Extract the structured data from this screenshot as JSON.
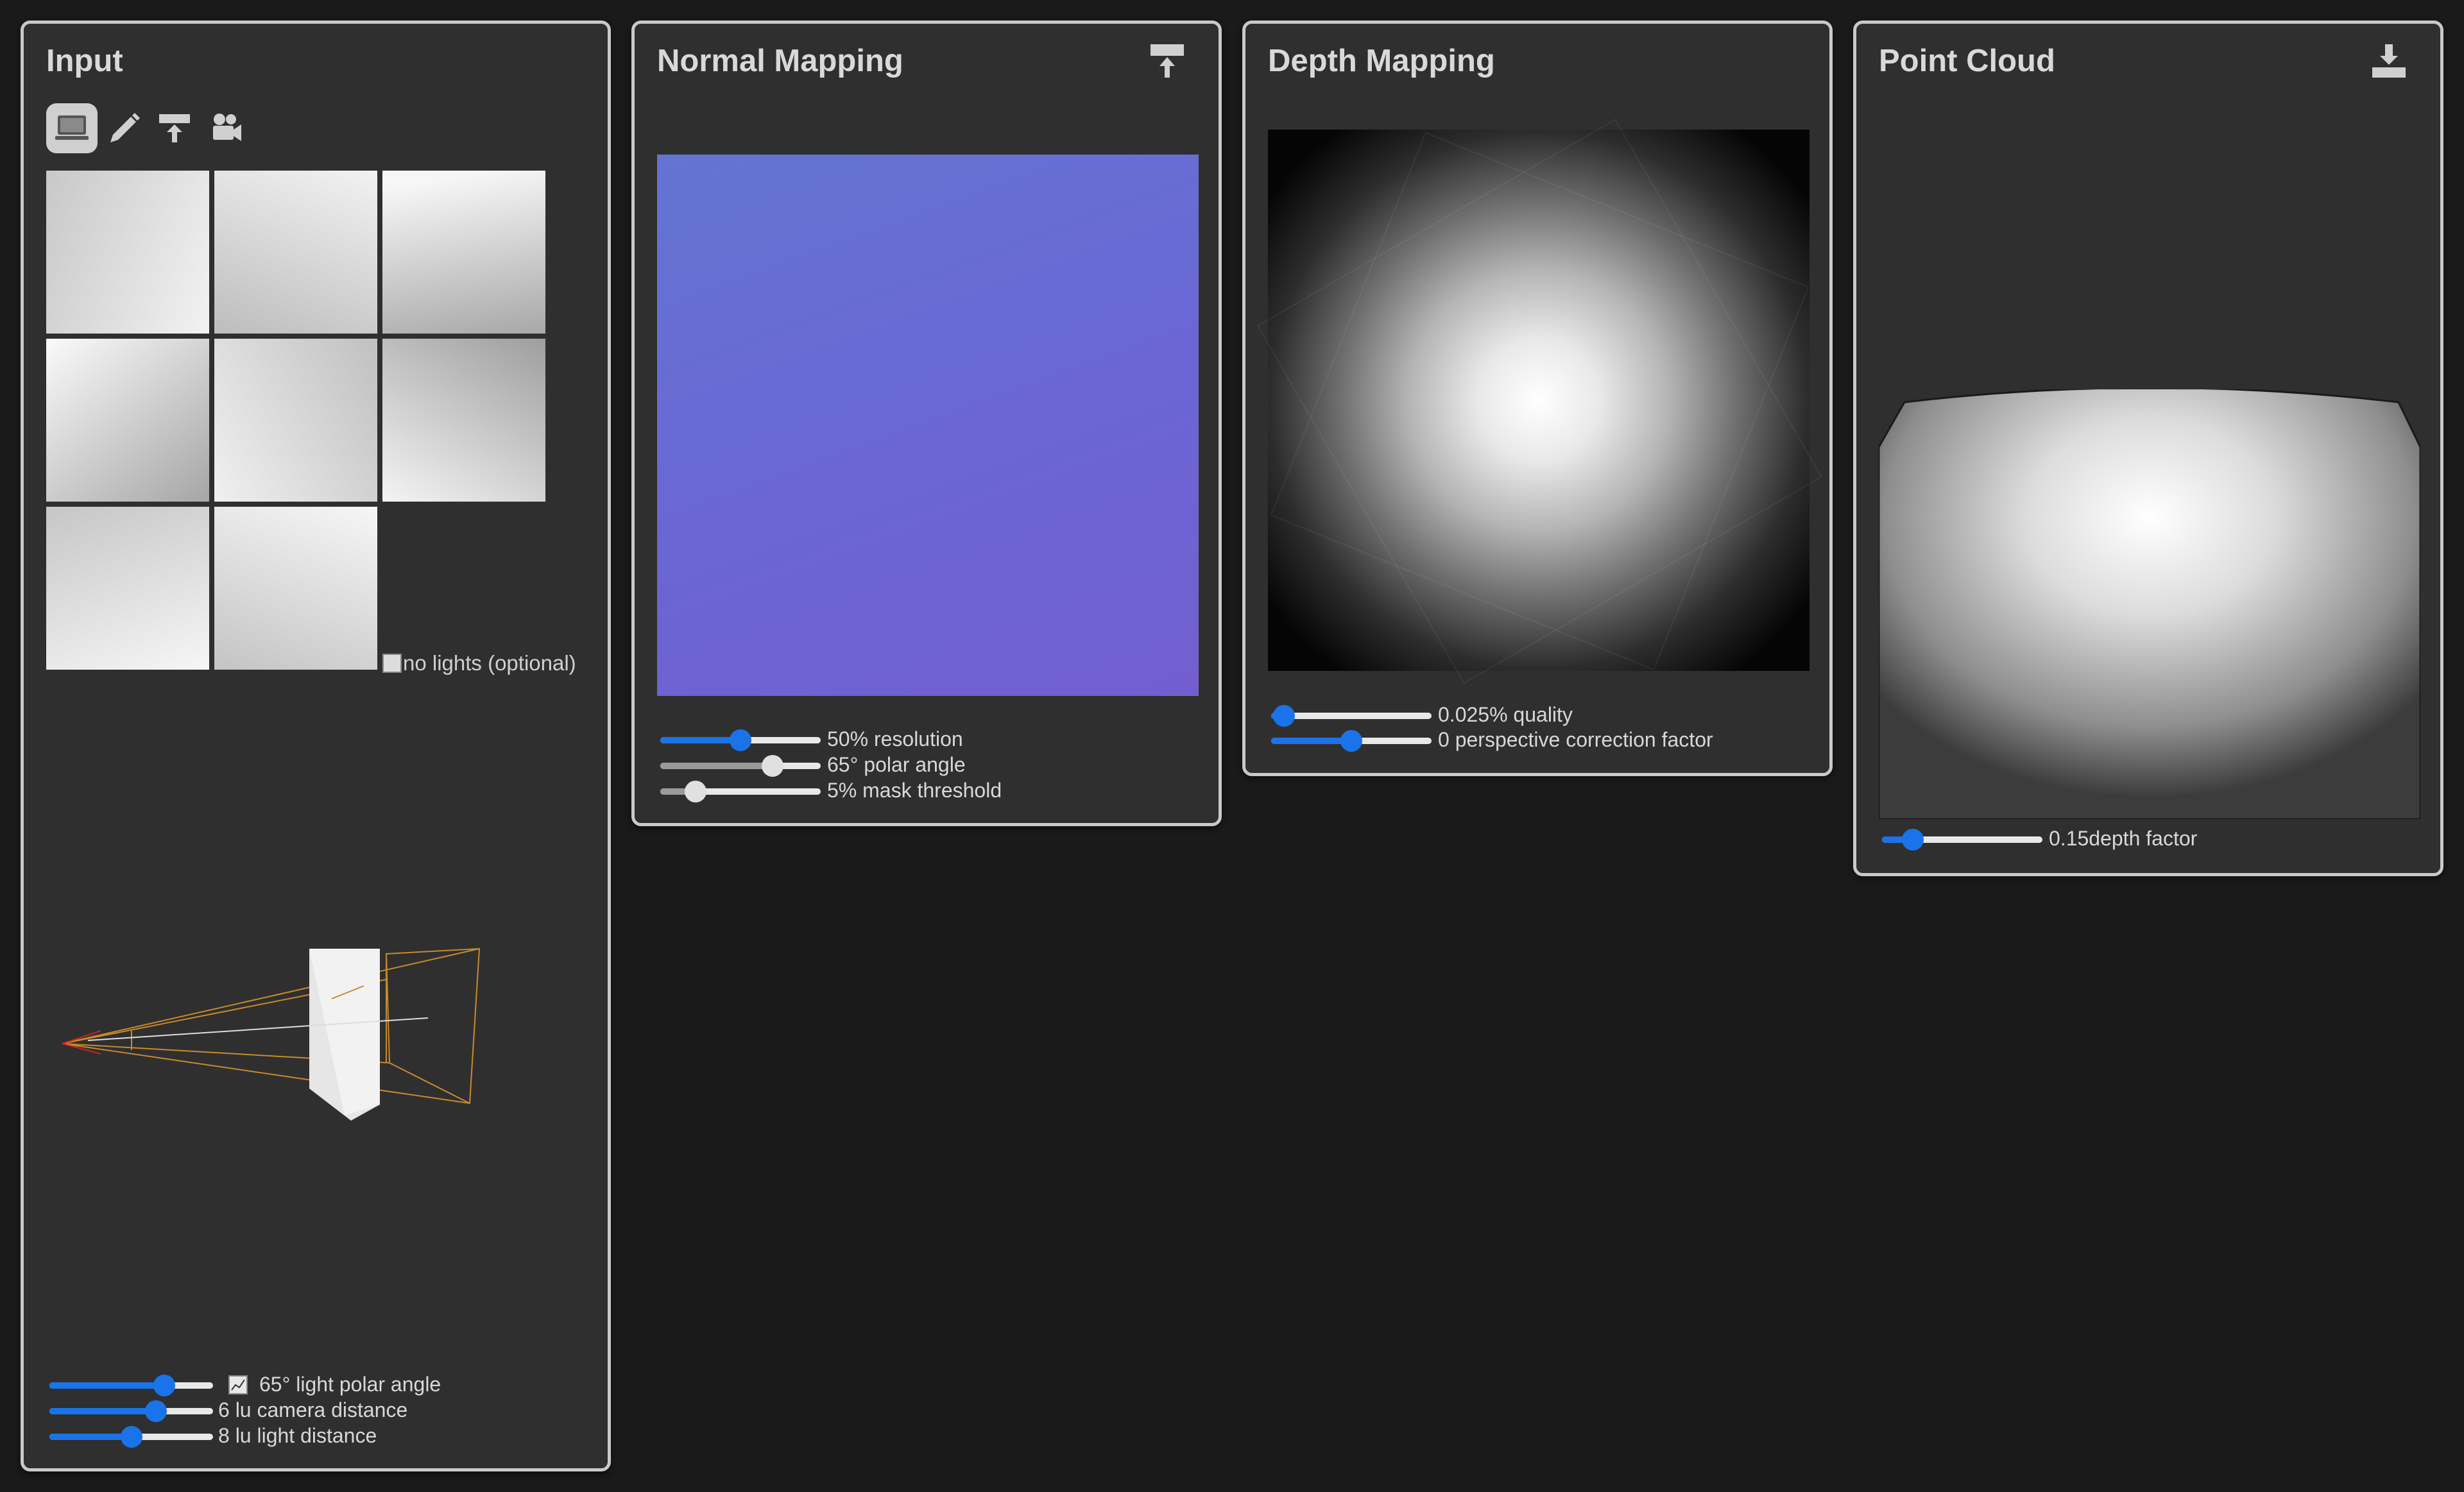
{
  "input": {
    "title": "Input",
    "tools": [
      {
        "name": "computer-icon",
        "active": true
      },
      {
        "name": "pencil-icon",
        "active": false
      },
      {
        "name": "upload-icon",
        "active": false
      },
      {
        "name": "video-camera-icon",
        "active": false
      }
    ],
    "thumbnails": 8,
    "no_lights_text": "no lights (optional)",
    "sliders": [
      {
        "value_fraction": 0.7,
        "label": "65° light polar angle",
        "icon": "chart-icon"
      },
      {
        "value_fraction": 0.65,
        "label": "6 lu camera distance"
      },
      {
        "value_fraction": 0.5,
        "label": "8 lu light distance"
      }
    ]
  },
  "normal": {
    "title": "Normal Mapping",
    "header_icon": "upload-icon",
    "map_color_top": "#6474d2",
    "map_color_bottom": "#735ecf",
    "sliders": [
      {
        "value_fraction": 0.5,
        "label": "50% resolution",
        "color": "blue"
      },
      {
        "value_fraction": 0.7,
        "label": "65° polar angle",
        "color": "gray"
      },
      {
        "value_fraction": 0.22,
        "label": "5% mask threshold",
        "color": "gray"
      }
    ]
  },
  "depth": {
    "title": "Depth Mapping",
    "sliders": [
      {
        "value_fraction": 0.08,
        "label": "0.025% quality"
      },
      {
        "value_fraction": 0.5,
        "label": "0 perspective correction factor"
      }
    ]
  },
  "cloud": {
    "title": "Point Cloud",
    "header_icon": "download-icon",
    "sliders": [
      {
        "value_fraction": 0.19,
        "label": "0.15depth factor"
      }
    ]
  },
  "colors": {
    "accent": "#1a73e8",
    "panel_bg": "#2f2f2f",
    "page_bg": "#1a1a1a",
    "panel_border": "#c9c9c9",
    "camera_frustum": "#c98a2b",
    "camera_origin": "#d02020"
  }
}
